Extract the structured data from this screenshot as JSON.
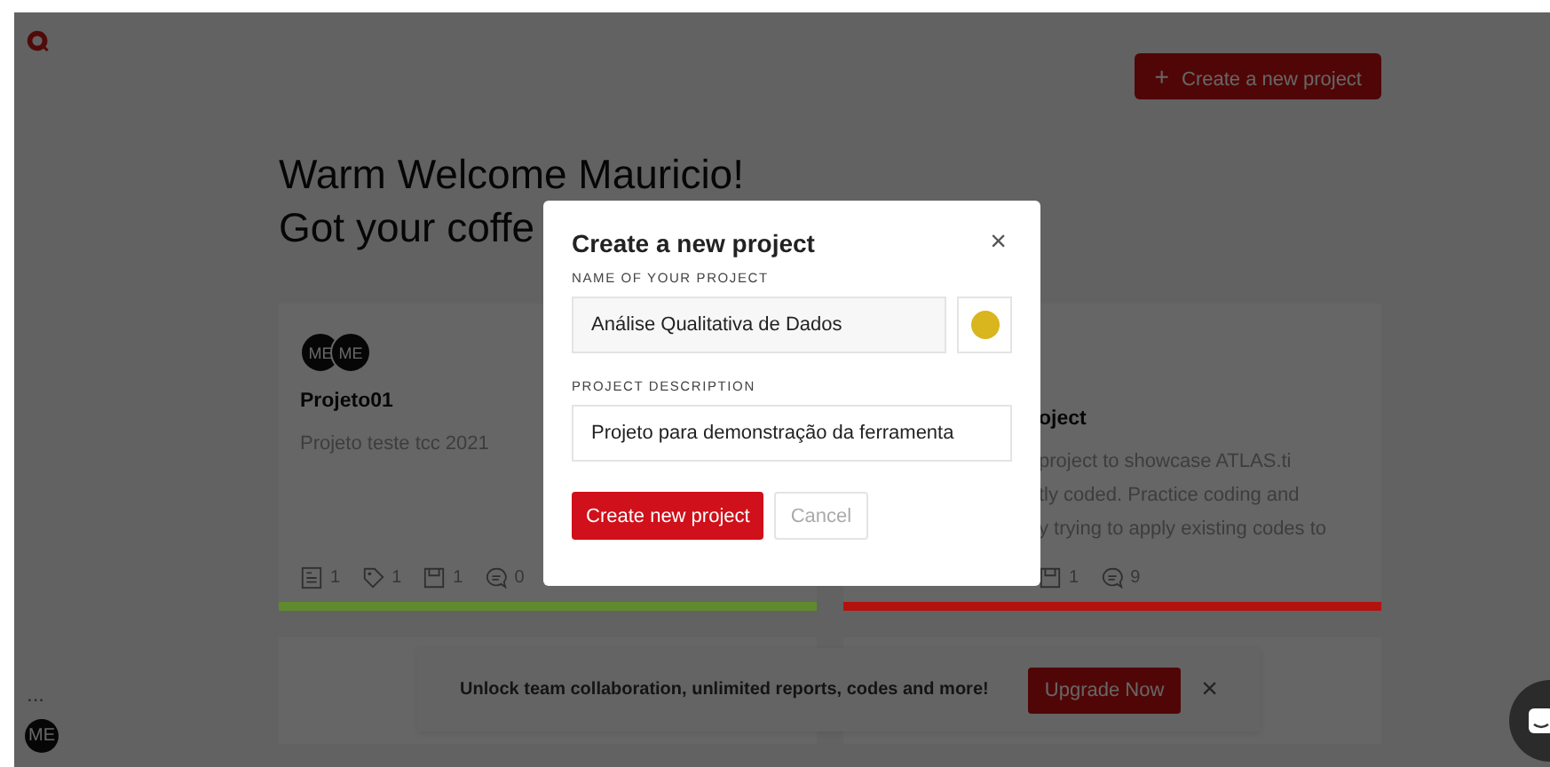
{
  "sidebar": {
    "more": "...",
    "user_avatar": "ME"
  },
  "header": {
    "create_icon": "+",
    "create_button": "Create a new project"
  },
  "welcome": [
    "Warm Welcome Mauricio!",
    "Got your coffe"
  ],
  "projects": [
    {
      "avatars": [
        "ME",
        "ME"
      ],
      "title": "Projeto01",
      "description": [
        "Projeto teste tcc 2021"
      ],
      "stats": [
        {
          "kind": "document",
          "count": "1"
        },
        {
          "kind": "tag",
          "count": "1"
        },
        {
          "kind": "memo",
          "count": "1"
        },
        {
          "kind": "comment",
          "count": "0"
        }
      ],
      "color": "#5f8a2e"
    },
    {
      "title": "oject",
      "description": [
        "project to showcase ATLAS.ti",
        "tly coded. Practice coding and",
        "y trying to apply existing codes to"
      ],
      "stats": [
        {
          "kind": "memo",
          "count": "1"
        },
        {
          "kind": "comment",
          "count": "9"
        }
      ],
      "color": "#b3120e"
    }
  ],
  "banner": {
    "text": "Unlock team collaboration, unlimited reports, codes and more!",
    "button": "Upgrade Now",
    "close": "×"
  },
  "modal": {
    "title": "Create a new project",
    "close": "×",
    "name_label": "NAME OF YOUR PROJECT",
    "name_value": "Análise Qualitativa de Dados",
    "color": "#d9b51e",
    "description_label": "PROJECT DESCRIPTION",
    "description_value": "Projeto para demonstração da ferramenta",
    "submit": "Create new project",
    "cancel": "Cancel"
  }
}
